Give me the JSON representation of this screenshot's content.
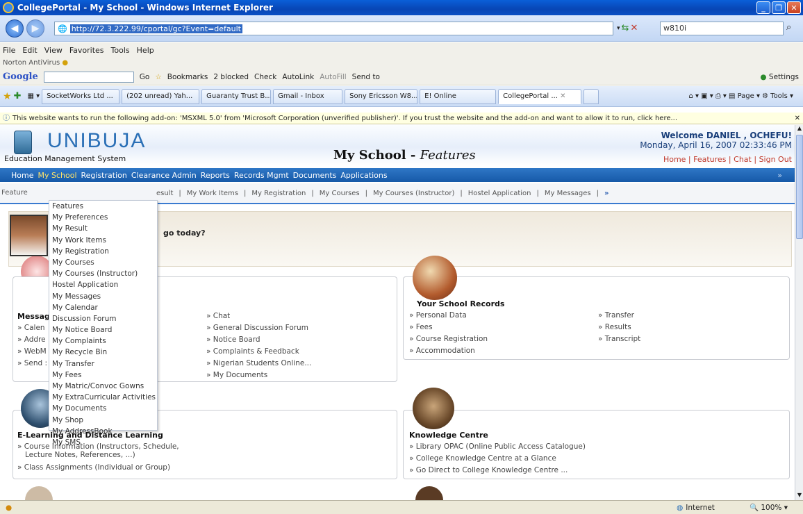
{
  "window": {
    "title": "CollegePortal - My School - Windows Internet Explorer"
  },
  "address": {
    "url": "http://72.3.222.99/cportal/gc?Event=default",
    "search": "w810i"
  },
  "menu": [
    "File",
    "Edit",
    "View",
    "Favorites",
    "Tools",
    "Help"
  ],
  "norton": "Norton AntiVirus",
  "googlebar": {
    "go": "Go",
    "bookmarks": "Bookmarks",
    "blocked": "2 blocked",
    "check": "Check",
    "autolink": "AutoLink",
    "autofill": "AutoFill",
    "sendto": "Send to",
    "settings": "Settings"
  },
  "tabs": [
    "SocketWorks Ltd ...",
    "(202 unread) Yah...",
    "Guaranty Trust B...",
    "Gmail - Inbox",
    "Sony Ericsson W8...",
    "E! Online",
    "CollegePortal ..."
  ],
  "toolbar_right": {
    "page": "Page",
    "tools": "Tools"
  },
  "infobar": "This website wants to run the following add-on: 'MSXML 5.0' from 'Microsoft Corporation (unverified publisher)'. If you trust the website and the add-on and want to allow it to run, click here...",
  "header": {
    "logo_text": "UNIBUJA",
    "subtitle": "Education Management System",
    "title_main": "My School - ",
    "title_italic": "Features",
    "welcome": "Welcome DANIEL , OCHEFU!",
    "date": "Monday, April 16, 2007 02:33:46 PM",
    "links": [
      "Home",
      "Features",
      "Chat",
      "Sign Out"
    ]
  },
  "nav": [
    "Home",
    "My School",
    "Registration",
    "Clearance Admin",
    "Reports",
    "Records Mgmt",
    "Documents",
    "Applications"
  ],
  "subnav": [
    "Feature",
    "esult",
    "My Work Items",
    "My Registration",
    "My Courses",
    "My Courses (Instructor)",
    "Hostel Application",
    "My Messages"
  ],
  "goday": "go today?",
  "dropdown": [
    "Features",
    "My Preferences",
    "My Result",
    "My Work Items",
    "My Registration",
    "My Courses",
    "My Courses (Instructor)",
    "Hostel Application",
    "My Messages",
    "My Calendar",
    "Discussion Forum",
    "My Notice Board",
    "My Complaints",
    "My Recycle Bin",
    "My Transfer",
    "My Fees",
    "My Matric/Convoc Gowns",
    "My ExtraCurricular Activities",
    "My Documents",
    "My Shop",
    "My AddressBook",
    "My SMS"
  ],
  "messaging": {
    "title_partial": "Messag",
    "left": [
      "» Calen",
      "» Addre",
      "» WebM",
      "» Send :"
    ],
    "right": [
      "» Chat",
      "» General Discussion Forum",
      "» Notice Board",
      "» Complaints & Feedback",
      "» Nigerian Students Online...",
      "» My Documents"
    ]
  },
  "records": {
    "title": "Your School Records",
    "left": [
      "» Personal Data",
      "» Fees",
      "» Course Registration",
      "» Accommodation"
    ],
    "right": [
      "» Transfer",
      "» Results",
      "» Transcript"
    ]
  },
  "elearning": {
    "title": "E-Learning and Distance Learning",
    "links": [
      "» Course Information (Instructors, Schedule,",
      "Lecture Notes, References, ...)",
      "» Class Assignments (Individual or Group)"
    ]
  },
  "knowledge": {
    "title": "Knowledge Centre",
    "links": [
      "» Library OPAC (Online Public Access Catalogue)",
      "» College Knowledge Centre at a Glance",
      "» Go Direct to College Knowledge Centre ..."
    ]
  },
  "status": {
    "zone": "Internet",
    "zoom": "100%"
  }
}
